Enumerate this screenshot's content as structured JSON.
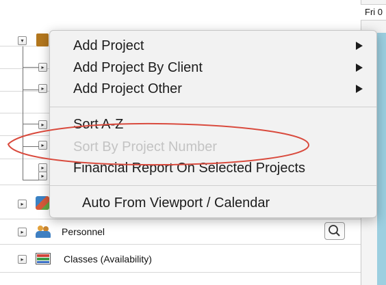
{
  "date_header": {
    "label": "Fri 0"
  },
  "tree": {
    "rows": [
      {
        "label": ""
      },
      {
        "label": ""
      },
      {
        "label": ""
      },
      {
        "label": ""
      },
      {
        "label": ""
      },
      {
        "label": ""
      },
      {
        "label": ""
      },
      {
        "label": "Personnel"
      },
      {
        "label": "Classes (Availability)"
      }
    ]
  },
  "context_menu": {
    "items": [
      {
        "label": "Add Project",
        "submenu": true,
        "disabled": false
      },
      {
        "label": "Add Project By Client",
        "submenu": true,
        "disabled": false
      },
      {
        "label": "Add Project Other",
        "submenu": true,
        "disabled": false
      },
      {
        "label": "Sort A-Z",
        "submenu": false,
        "disabled": false
      },
      {
        "label": "Sort By Project Number",
        "submenu": false,
        "disabled": true
      },
      {
        "label": "Financial Report On Selected Projects",
        "submenu": false,
        "disabled": false
      },
      {
        "label": "Auto From Viewport / Calendar",
        "submenu": false,
        "disabled": false
      }
    ]
  },
  "annotation": {
    "color": "#d94a3d"
  },
  "colors": {
    "blue_bar": "#9ccfe0",
    "menu_bg": "#f2f2f2"
  }
}
